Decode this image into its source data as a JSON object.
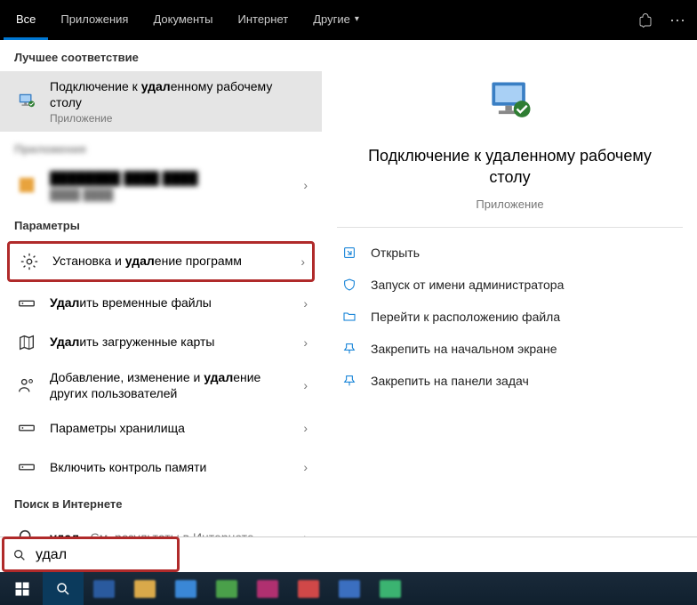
{
  "topbar": {
    "tabs": [
      {
        "label": "Все",
        "active": true
      },
      {
        "label": "Приложения",
        "active": false
      },
      {
        "label": "Документы",
        "active": false
      },
      {
        "label": "Интернет",
        "active": false
      },
      {
        "label": "Другие",
        "active": false,
        "dropdown": true
      }
    ]
  },
  "sections": {
    "bestMatch": "Лучшее соответствие",
    "apps": "Приложения",
    "settings": "Параметры",
    "web": "Поиск в Интернете"
  },
  "bestMatch": {
    "title_pre": "Подключение к ",
    "title_hl": "удал",
    "title_post": "енному рабочему столу",
    "subtitle": "Приложение"
  },
  "settingsItems": [
    {
      "pre": "Установка и ",
      "hl": "удал",
      "post": "ение программ"
    },
    {
      "pre": "",
      "hl": "Удал",
      "post": "ить временные файлы"
    },
    {
      "pre": "",
      "hl": "Удал",
      "post": "ить загруженные карты"
    },
    {
      "pre": "Добавление, изменение и ",
      "hl": "удал",
      "post": "ение других пользователей"
    },
    {
      "pre": "Параметры хранилища",
      "hl": "",
      "post": ""
    },
    {
      "pre": "Включить контроль памяти",
      "hl": "",
      "post": ""
    }
  ],
  "webItem": {
    "hl": "удал",
    "suffix": " - См. результаты в Интернете"
  },
  "preview": {
    "title": "Подключение к удаленному рабочему столу",
    "subtitle": "Приложение"
  },
  "actions": [
    "Открыть",
    "Запуск от имени администратора",
    "Перейти к расположению файла",
    "Закрепить на начальном экране",
    "Закрепить на панели задач"
  ],
  "search": {
    "query": "удал"
  }
}
